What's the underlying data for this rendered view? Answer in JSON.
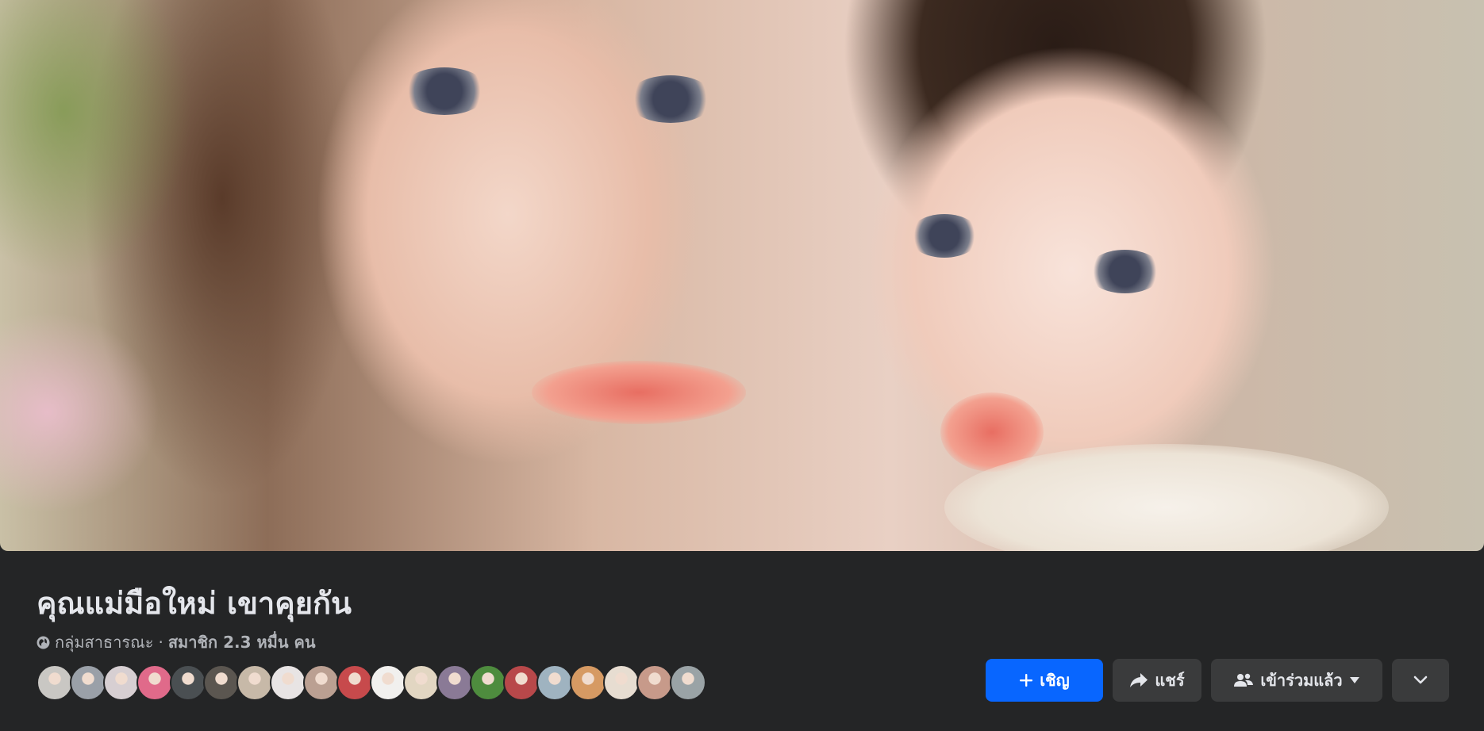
{
  "group": {
    "name": "คุณแม่มือใหม่ เขาคุยกัน",
    "privacy": "กลุ่มสาธารณะ",
    "separator": "·",
    "members": "สมาชิก 2.3 หมื่น คน"
  },
  "cover": {
    "icon": "cover-photo"
  },
  "avatar_colors": [
    "#c9c7c3",
    "#9aa0a8",
    "#d7cfd2",
    "#e06a8a",
    "#4a4f52",
    "#5b5650",
    "#c7b9a8",
    "#e8e4e4",
    "#bba092",
    "#c74a4c",
    "#f1f0ee",
    "#e2d6c2",
    "#8a7a96",
    "#4e8c3e",
    "#b8484a",
    "#9fb3c0",
    "#d69a63",
    "#e7ddd1",
    "#c79a8a",
    "#9aa3a6"
  ],
  "actions": {
    "invite_label": "เชิญ",
    "share_label": "แชร์",
    "joined_label": "เข้าร่วมแล้ว"
  },
  "colors": {
    "primary": "#0866ff",
    "background": "#242526",
    "button": "#3a3b3c"
  }
}
